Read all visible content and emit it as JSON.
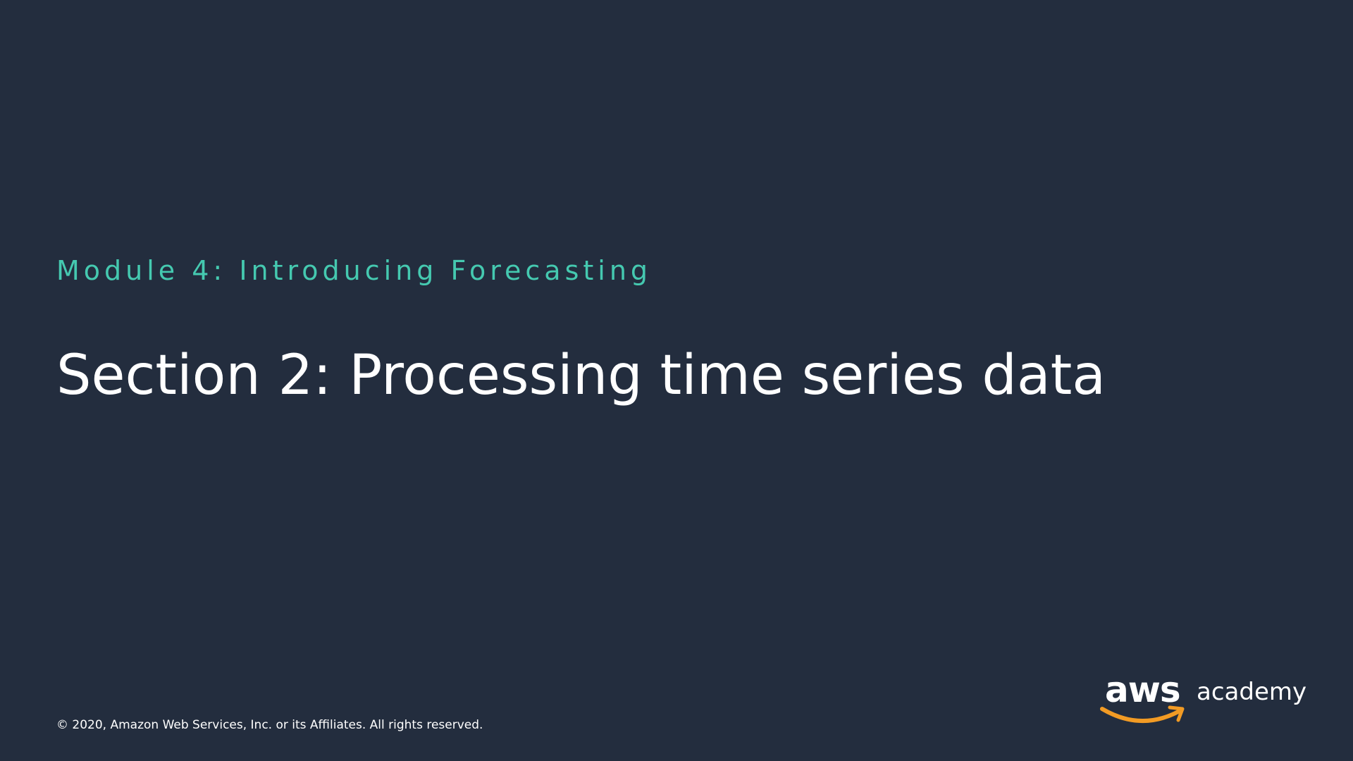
{
  "slide": {
    "module_label": "Module 4: Introducing Forecasting",
    "title": "Section 2: Processing time series data",
    "copyright": "© 2020, Amazon Web Services, Inc. or its Affiliates. All rights reserved."
  },
  "logo": {
    "wordmark": "aws",
    "product": "academy",
    "smile_icon": "amazon-smile-arrow-icon"
  },
  "colors": {
    "background": "#232d3e",
    "accent": "#45c9b0",
    "text": "#ffffff",
    "logo_smile": "#f29b24"
  }
}
